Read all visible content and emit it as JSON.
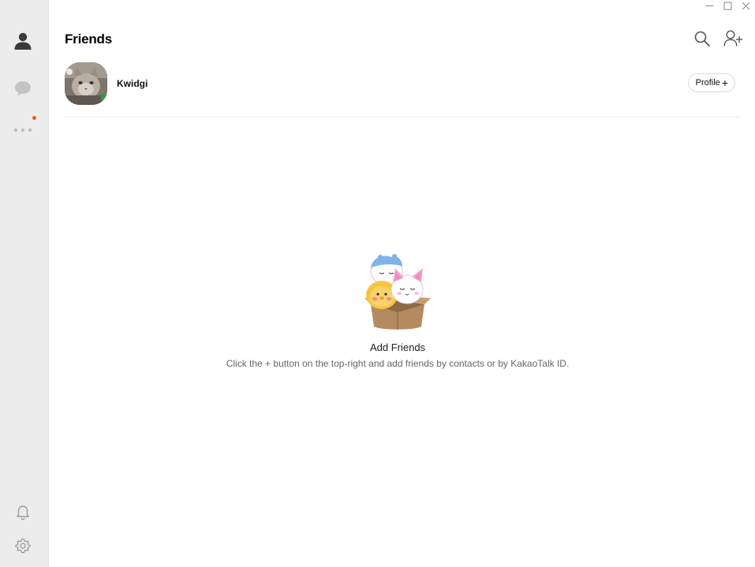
{
  "window": {
    "minimize_icon": "minimize-icon",
    "maximize_icon": "maximize-icon",
    "close_icon": "close-icon"
  },
  "sidebar": {
    "items": [
      {
        "name": "friends",
        "icon": "person-icon",
        "active": true
      },
      {
        "name": "chats",
        "icon": "chat-bubble-icon",
        "active": false
      },
      {
        "name": "more",
        "icon": "more-dots-icon",
        "active": false,
        "has_notification": true
      }
    ],
    "bottom_items": [
      {
        "name": "notifications",
        "icon": "bell-icon"
      },
      {
        "name": "settings",
        "icon": "gear-icon"
      }
    ],
    "notification_color": "#f25a1d"
  },
  "header": {
    "title": "Friends",
    "search_icon": "search-icon",
    "add_friend_icon": "add-friend-icon"
  },
  "profile": {
    "name": "Kwidgi",
    "button_label": "Profile",
    "button_plus": "+"
  },
  "empty_state": {
    "title": "Add Friends",
    "description": "Click the + button on the top-right and add friends by contacts or by KakaoTalk ID."
  },
  "colors": {
    "sidebar_bg": "#ececec",
    "main_bg": "#ffffff",
    "accent_dot": "#f25a1d"
  }
}
